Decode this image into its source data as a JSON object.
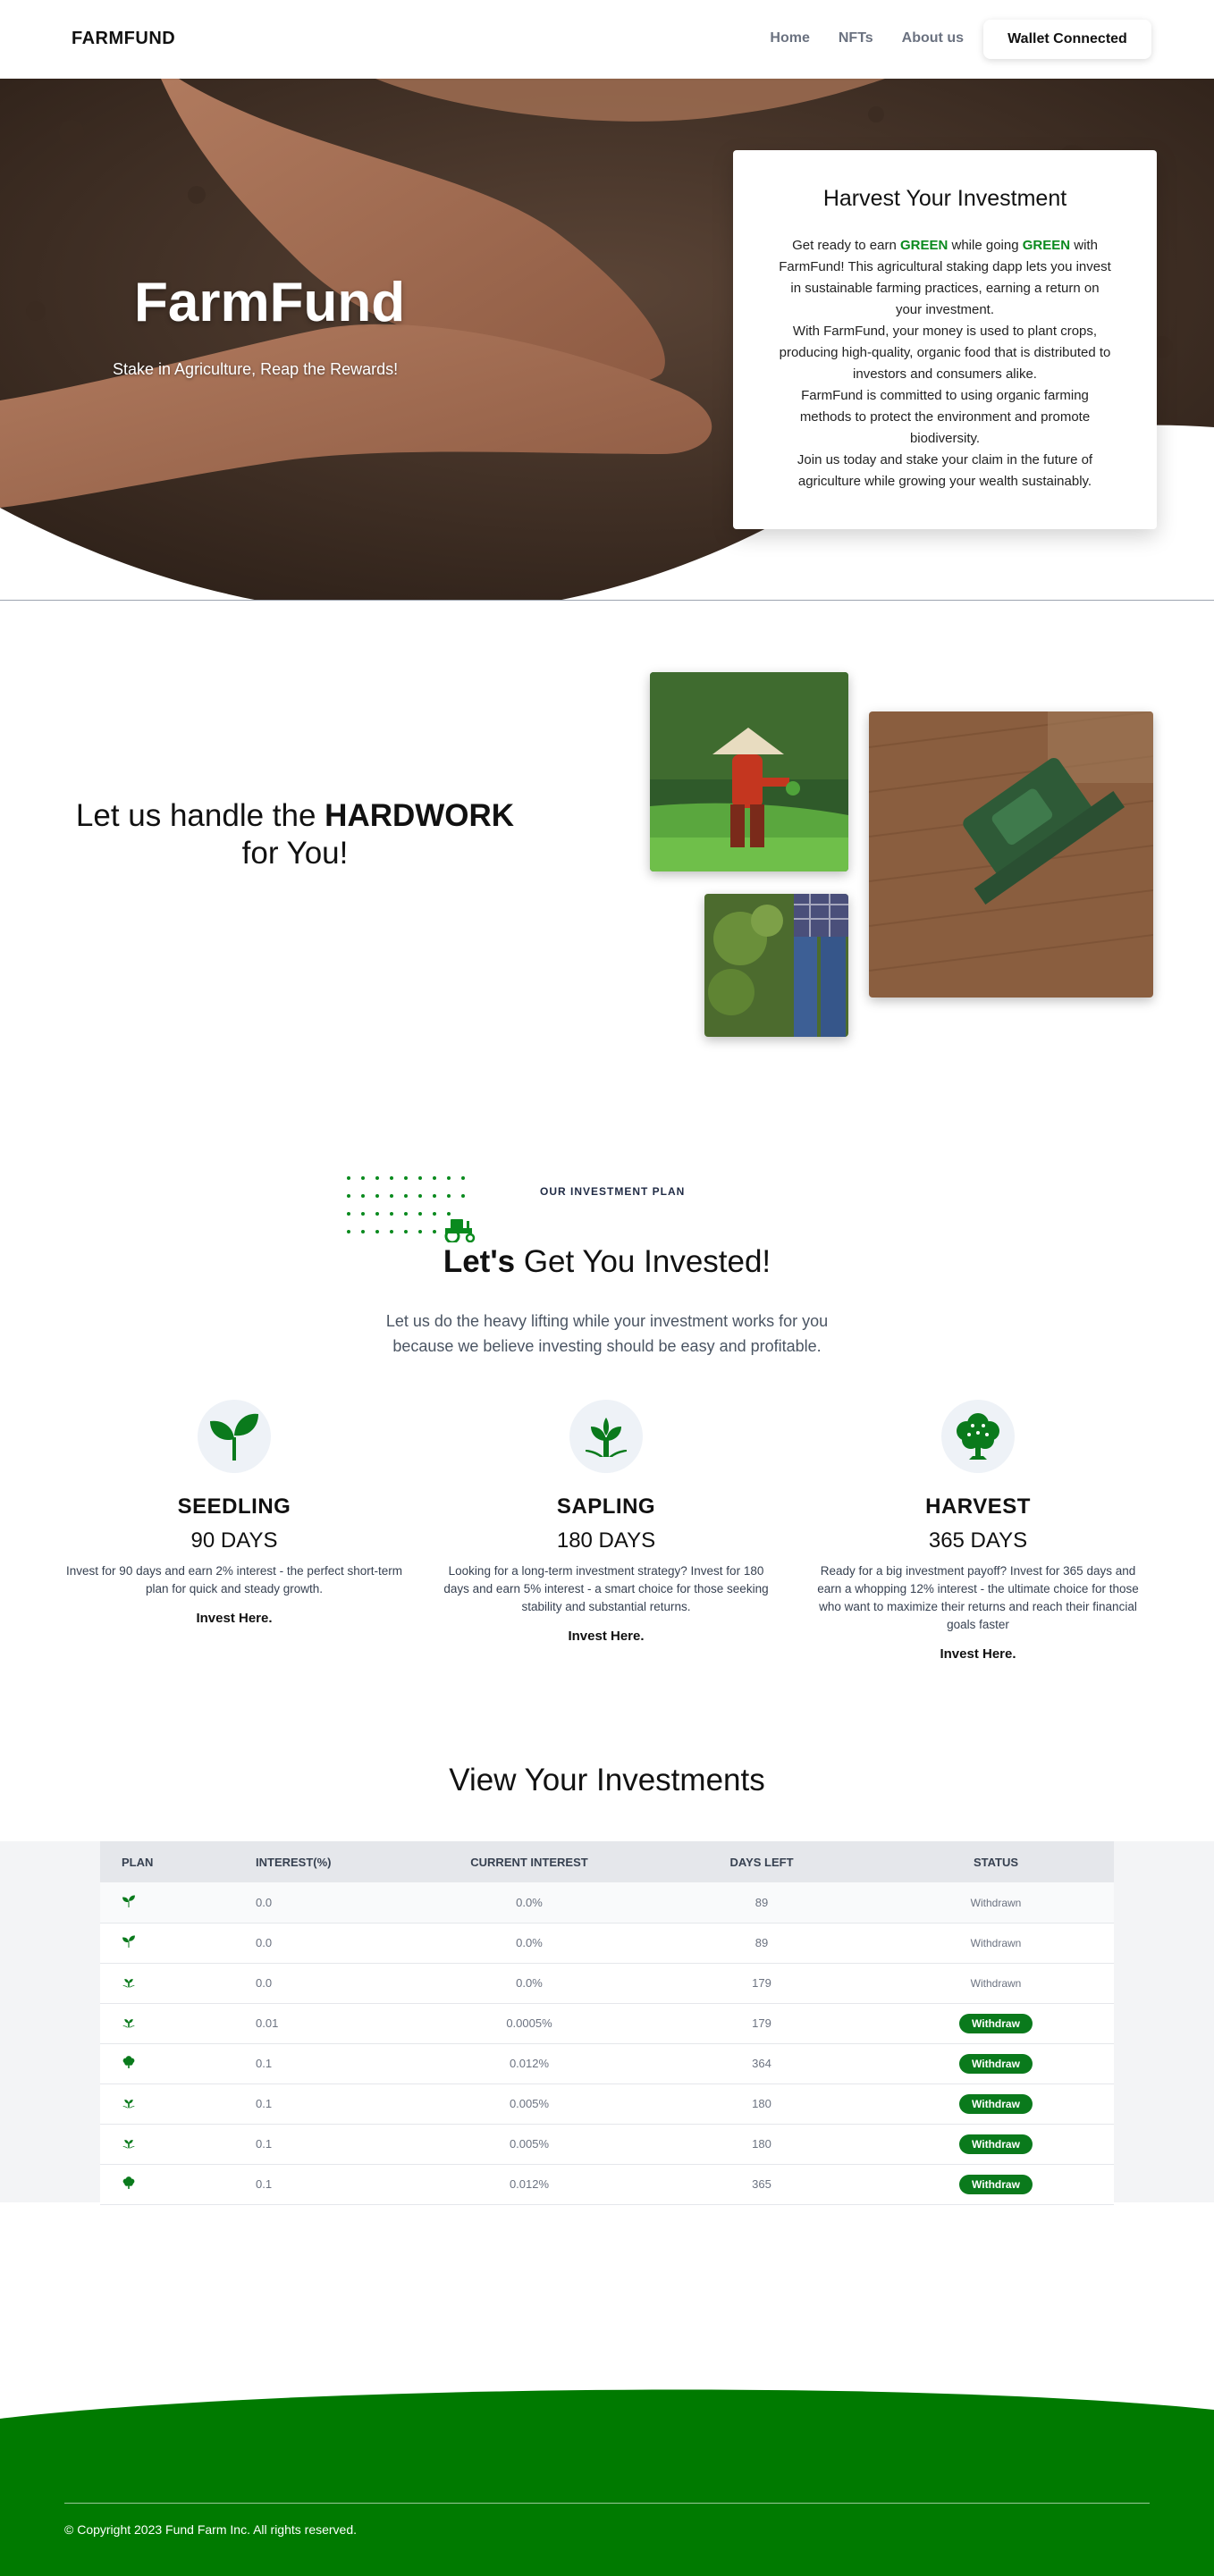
{
  "nav": {
    "brand": "FARMFUND",
    "links": [
      "Home",
      "NFTs",
      "About us"
    ],
    "wallet_button": "Wallet Connected"
  },
  "hero": {
    "title": "FarmFund",
    "subtitle": "Stake in Agriculture, Reap the Rewards!"
  },
  "card": {
    "title": "Harvest Your Investment",
    "p1_a": "Get ready to earn ",
    "p1_green1": "GREEN",
    "p1_b": " while going ",
    "p1_green2": "GREEN",
    "p1_c": " with FarmFund! This agricultural staking dapp lets you invest in sustainable farming practices, earning a return on your investment.",
    "p2": "With FarmFund, your money is used to plant crops, producing high-quality, organic food that is distributed to investors and consumers alike.",
    "p3": "FarmFund is committed to using organic farming methods to protect the environment and promote biodiversity.",
    "p4": "Join us today and stake your claim in the future of agriculture while growing your wealth sustainably."
  },
  "hardwork": {
    "line1_a": "Let us handle the ",
    "line1_b": "HARDWORK",
    "line2": "for You!"
  },
  "investment_plan": {
    "label": "OUR INVESTMENT PLAN",
    "title_bold": "Let's",
    "title_rest": " Get You Invested!",
    "subtitle": "Let us do the heavy lifting while your investment works for you because we believe investing should be easy and profitable.",
    "plans": [
      {
        "name": "SEEDLING",
        "days": "90 DAYS",
        "desc": "Invest for 90 days and earn 2% interest - the perfect short-term plan for quick and steady growth.",
        "link": "Invest Here.",
        "icon": "seedling-icon"
      },
      {
        "name": "SAPLING",
        "days": "180 DAYS",
        "desc": "Looking for a long-term investment strategy? Invest for 180 days and earn 5% interest - a smart choice for those seeking stability and substantial returns.",
        "link": "Invest Here.",
        "icon": "sapling-icon"
      },
      {
        "name": "HARVEST",
        "days": "365 DAYS",
        "desc": "Ready for a big investment payoff? Invest for 365 days and earn a whopping 12% interest - the ultimate choice for those who want to maximize their returns and reach their financial goals faster",
        "link": "Invest Here.",
        "icon": "tree-icon"
      }
    ]
  },
  "investments": {
    "title": "View Your Investments",
    "headers": [
      "PLAN",
      "INTEREST(%)",
      "CURRENT INTEREST",
      "DAYS LEFT",
      "STATUS"
    ],
    "rows": [
      {
        "icon": "seedling-icon",
        "interest": "0.0",
        "current": "0.0%",
        "days": "89",
        "status": "Withdrawn"
      },
      {
        "icon": "seedling-icon",
        "interest": "0.0",
        "current": "0.0%",
        "days": "89",
        "status": "Withdrawn"
      },
      {
        "icon": "sapling-icon",
        "interest": "0.0",
        "current": "0.0%",
        "days": "179",
        "status": "Withdrawn"
      },
      {
        "icon": "sapling-icon",
        "interest": "0.01",
        "current": "0.0005%",
        "days": "179",
        "status": "Withdraw"
      },
      {
        "icon": "tree-icon",
        "interest": "0.1",
        "current": "0.012%",
        "days": "364",
        "status": "Withdraw"
      },
      {
        "icon": "sapling-icon",
        "interest": "0.1",
        "current": "0.005%",
        "days": "180",
        "status": "Withdraw"
      },
      {
        "icon": "sapling-icon",
        "interest": "0.1",
        "current": "0.005%",
        "days": "180",
        "status": "Withdraw"
      },
      {
        "icon": "tree-icon",
        "interest": "0.1",
        "current": "0.012%",
        "days": "365",
        "status": "Withdraw"
      }
    ]
  },
  "footer": {
    "copyright": "© Copyright 2023 Fund Farm Inc. All rights reserved."
  },
  "colors": {
    "brand_green": "#007a00",
    "button_green": "#0a7a1c",
    "text_dark": "#111827"
  }
}
